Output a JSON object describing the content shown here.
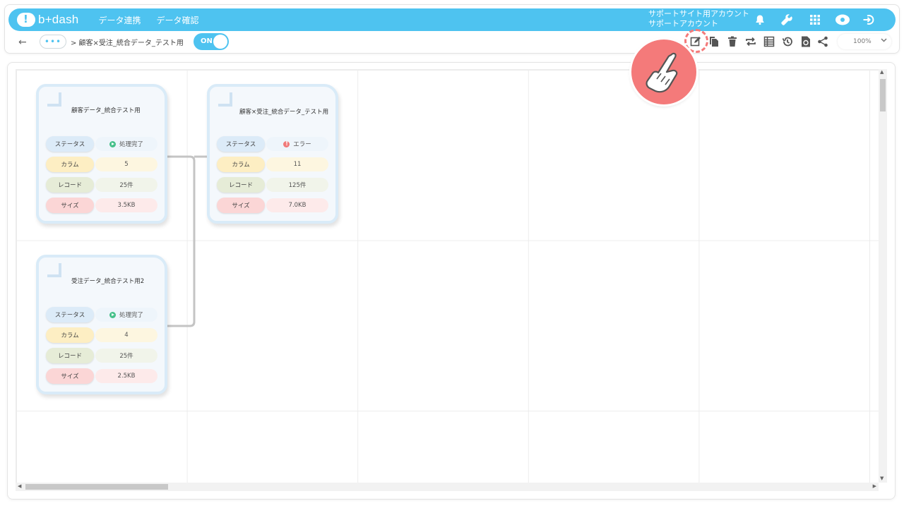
{
  "app": {
    "logo_text": "b+dash",
    "nav": [
      "データ連携",
      "データ確認"
    ]
  },
  "account": {
    "line1": "サポートサイト用アカウント",
    "line2": "サポートアカウント"
  },
  "header_icons": [
    "bell-icon",
    "wrench-icon",
    "grid-apps-icon",
    "user-avatar-icon",
    "logout-icon"
  ],
  "toolbar": {
    "back_label": "←",
    "more_label": "•••",
    "breadcrumb": "> 顧客×受注_統合データ_テスト用",
    "toggle_label": "ON",
    "icons": [
      "edit-icon",
      "copy-icon",
      "trash-icon",
      "repeat-icon",
      "table-icon",
      "history-icon",
      "refresh-file-icon",
      "share-icon"
    ],
    "zoom": "100%"
  },
  "labels": {
    "status": "ステータス",
    "columns": "カラム",
    "records": "レコード",
    "size": "サイズ"
  },
  "cards": [
    {
      "title": "顧客データ_統合テスト用",
      "status": "処理完了",
      "status_type": "ok",
      "columns": "5",
      "records": "25件",
      "size": "3.5KB"
    },
    {
      "title": "顧客×受注_統合データ_テスト用",
      "status": "エラー",
      "status_type": "error",
      "columns": "11",
      "records": "125件",
      "size": "7.0KB"
    },
    {
      "title": "受注データ_統合テスト用2",
      "status": "処理完了",
      "status_type": "ok",
      "columns": "4",
      "records": "25件",
      "size": "2.5KB"
    }
  ],
  "colors": {
    "brand": "#4ec3f0",
    "ok": "#45c08a",
    "error": "#f07a7a",
    "pointer": "#f47a7a"
  }
}
